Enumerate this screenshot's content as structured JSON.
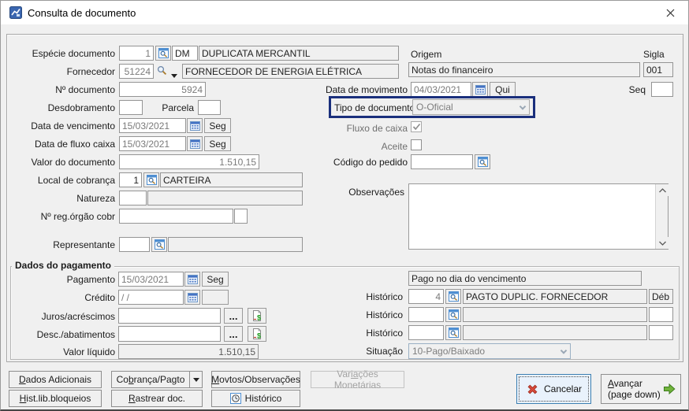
{
  "window": {
    "title": "Consulta de documento"
  },
  "colors": {
    "highlight_border": "#1a2f7c",
    "focus_button_border": "#3c7fb1",
    "focus_button_bg": "#e9f2fc",
    "cancel_x": "#d84b3c",
    "advance_arrow": "#71b33c",
    "dialog_bg": "#f0f0f0"
  },
  "doc": {
    "especie": {
      "label": "Espécie documento",
      "code": "1",
      "tipo": "DM",
      "desc": "DUPLICATA MERCANTIL"
    },
    "fornecedor": {
      "label": "Fornecedor",
      "code": "51224",
      "desc": "FORNECEDOR DE ENERGIA ELÉTRICA"
    },
    "num_documento": {
      "label": "Nº documento",
      "value": "5924"
    },
    "desdobramento": {
      "label": "Desdobramento",
      "value": ""
    },
    "parcela": {
      "label": "Parcela",
      "value": ""
    },
    "data_vencimento": {
      "label": "Data de vencimento",
      "value": "15/03/2021",
      "dow": "Seg"
    },
    "data_fluxo": {
      "label": "Data de fluxo caixa",
      "value": "15/03/2021",
      "dow": "Seg"
    },
    "valor_documento": {
      "label": "Valor do documento",
      "value": "1.510,15"
    },
    "local_cobranca": {
      "label": "Local de cobrança",
      "code": "1",
      "desc": "CARTEIRA"
    },
    "natureza": {
      "label": "Natureza",
      "code": "",
      "desc": ""
    },
    "reg_orgao": {
      "label": "Nº reg.órgão cobr",
      "value": "",
      "value2": ""
    },
    "representante": {
      "label": "Representante",
      "code": "",
      "desc": ""
    },
    "origem": {
      "label": "Origem",
      "value": "Notas do financeiro"
    },
    "sigla": {
      "label": "Sigla",
      "value": "001"
    },
    "data_movimento": {
      "label": "Data de movimento",
      "value": "04/03/2021",
      "dow": "Qui"
    },
    "seq": {
      "label": "Seq",
      "value": ""
    },
    "tipo_documento": {
      "label": "Tipo de documento",
      "value": "O-Oficial"
    },
    "fluxo_caixa": {
      "label": "Fluxo de caixa",
      "checked": true
    },
    "aceite": {
      "label": "Aceite",
      "checked": false
    },
    "codigo_pedido": {
      "label": "Código do pedido",
      "value": ""
    },
    "observacoes": {
      "label": "Observações",
      "value": ""
    }
  },
  "pagamento": {
    "group_label": "Dados do pagamento",
    "pagamento": {
      "label": "Pagamento",
      "value": "15/03/2021",
      "dow": "Seg"
    },
    "credito": {
      "label": "Crédito",
      "value": "/ /"
    },
    "juros": {
      "label": "Juros/acréscimos",
      "value": ""
    },
    "descontos": {
      "label": "Desc./abatimentos",
      "value": ""
    },
    "valor_liquido": {
      "label": "Valor líquido",
      "value": "1.510,15"
    },
    "status_text": "Pago no dia do vencimento",
    "historico1": {
      "label": "Histórico",
      "code": "4",
      "desc": "PAGTO DUPLIC. FORNECEDOR",
      "tipo": "Déb"
    },
    "historico2": {
      "label": "Histórico",
      "code": "",
      "desc": "",
      "tipo": ""
    },
    "historico3": {
      "label": "Histórico",
      "code": "",
      "desc": "",
      "tipo": ""
    },
    "situacao": {
      "label": "Situação",
      "value": "10-Pago/Baixado"
    }
  },
  "footer": {
    "dados_adicionais": {
      "pre": "",
      "u": "D",
      "post": "ados Adicionais"
    },
    "cobranca_pagto": {
      "pre": "Co",
      "u": "b",
      "post": "rança/Pagto"
    },
    "movtos": {
      "pre": "",
      "u": "M",
      "post": "ovtos/Observações"
    },
    "variacoes": {
      "pre": "Var",
      "u": "ia",
      "post": "ções Monetárias"
    },
    "hist_lib": {
      "pre": "",
      "u": "H",
      "post": "ist.lib.bloqueios"
    },
    "rastrear": {
      "pre": "",
      "u": "R",
      "post": "astrear doc."
    },
    "historico": "Histórico",
    "cancelar": "Cancelar",
    "avancar": {
      "pre": "",
      "u": "A",
      "post": "vançar",
      "line2": "(page down)"
    },
    "ellipsis": "..."
  }
}
